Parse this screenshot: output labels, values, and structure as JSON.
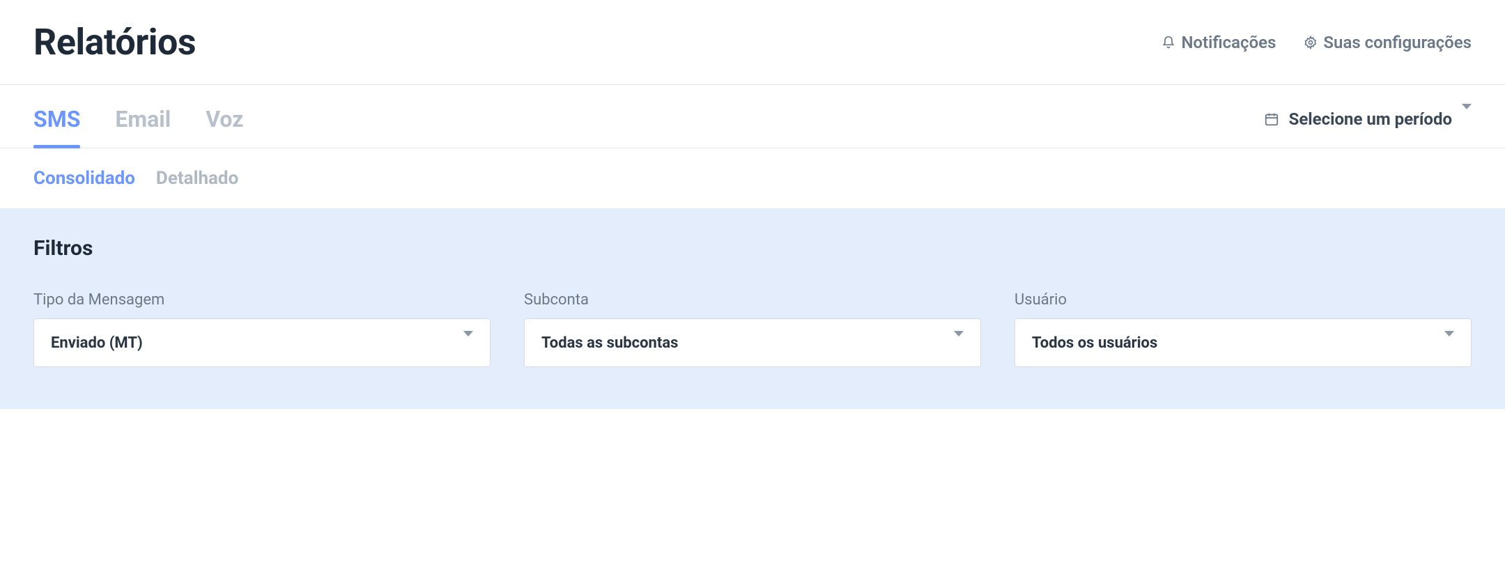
{
  "header": {
    "title": "Relatórios",
    "notifications": "Notificações",
    "settings": "Suas configurações"
  },
  "tabs": {
    "sms": "SMS",
    "email": "Email",
    "voz": "Voz"
  },
  "period_picker": {
    "label": "Selecione um período"
  },
  "subtabs": {
    "consolidado": "Consolidado",
    "detalhado": "Detalhado"
  },
  "filters": {
    "title": "Filtros",
    "tipo": {
      "label": "Tipo da Mensagem",
      "value": "Enviado (MT)"
    },
    "subconta": {
      "label": "Subconta",
      "value": "Todas as subcontas"
    },
    "usuario": {
      "label": "Usuário",
      "value": "Todos os usuários"
    }
  }
}
